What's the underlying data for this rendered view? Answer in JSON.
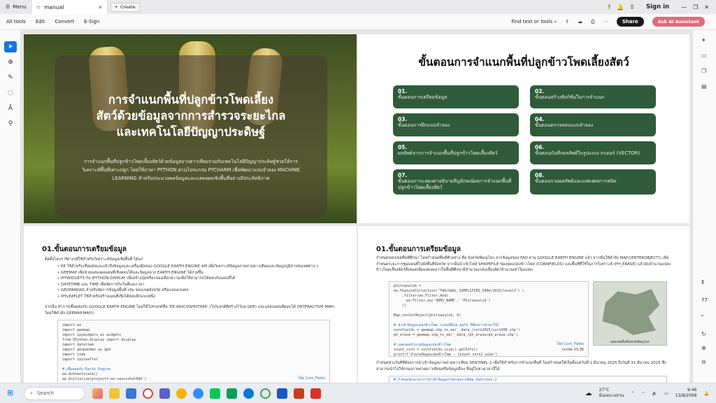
{
  "titlebar": {
    "menu_label": "Menu",
    "tab_title": "manual",
    "create_label": "Create",
    "signin_label": "Sign in"
  },
  "toolbar": {
    "items": [
      "All tools",
      "Edit",
      "Convert",
      "E-Sign"
    ],
    "find_label": "Find text or tools",
    "share_label": "Share",
    "ai_label": "Ask AI Assistant"
  },
  "page_indicator": "77",
  "slide1": {
    "title_lines": [
      "การจำแนกพื้นที่ปลูกข้าวโพดเลี้ยง",
      "สัตว์ด้วยข้อมูลจากการสำรวจระยะไกล",
      "และเทคโนโลยีปัญญาประดิษฐ์"
    ],
    "description": "การจำแนกพื้นที่ปลูกข้าวโพดเลี้ยงสัตว์ด้วยข้อมูลจากดาวเทียมร่วมกับเทคโนโลยีปัญญาประดิษฐ์ช่วยให้การวิเคราะห์พื้นที่เพาะปลูก โดยใช้ภาษา PYTHON ผ่านโปรแกรม PYCHARM เพื่อพัฒนาแบบจำลอง MACHINE LEARNING สำหรับประมวลผลข้อมูลและแสดงผลเชิงพื้นที่อย่างมีประสิทธิภาพ"
  },
  "slide2": {
    "title": "ขั้นตอนการจำแนกพื้นที่ปลูกข้าวโพดเลี้ยงสัตว์",
    "steps": [
      {
        "n": "01.",
        "t": "ขั้นตอนการเตรียมข้อมูล"
      },
      {
        "n": "02.",
        "t": "ขั้นตอนสร้างฟังก์ชันในการจำแนก"
      },
      {
        "n": "03.",
        "t": "ขั้นตอนการฝึกแบบจำลอง"
      },
      {
        "n": "04.",
        "t": "ขั้นตอนตรวจสอบแบบจำลอง"
      },
      {
        "n": "05.",
        "t": "ผลลัพธ์จากการจำแนกพื้นที่ปลูกข้าวโพดเลี้ยงสัตว์"
      },
      {
        "n": "06.",
        "t": "ขั้นตอนบันทึกผลลัพธ์ในรูปแบบเวกเตอร์ (VECTOR)"
      },
      {
        "n": "07.",
        "t": "ขั้นตอนการแสดงค่าอธิบายสัญลักษณ์ผลการจำแนกพื้นที่ปลูกข้าวโพดเลี้ยงสัตว์"
      },
      {
        "n": "08.",
        "t": "ขั้นตอนรวมผลลัพธ์และแสดงผลการสถิต"
      }
    ]
  },
  "slide3": {
    "heading": "01.ขั้นตอนการเตรียมข้อมูล",
    "intro": "ติดตั้งไลบรารีต่างๆที่ใช้สำหรับวิเคราะห์ข้อมูลเชิงพื้นที่ ได้แก่",
    "bullets": [
      "EE ใช้สำหรับเชื่อมต่อและเข้าถึงข้อมูลและเครื่องมือของ GOOGLE EARTH ENGINE API เพื่อวิเคราะห์ข้อมูลภาพถ่ายดาวเทียมและข้อมูลภูมิสารสนเทศต่าง ๆ",
      "GEEMAP เพื่อช่วยแสดงผลแผนที่เชิงตอบโต้และข้อมูลจาก EARTH ENGINE ได้ง่ายขึ้น",
      "IPYWIDGETS กับ IPYTHON.DISPLAY เพื่อสร้างปุ่มหรือกล่องเลือกความเพื่อให้สามารถโต้ตอบกับแผนที่ได้",
      "DATETIME และ TIME เพื่อจัดการกับวันที่และเวลา",
      "GEOPANDAS สำหรับจัดการข้อมูลพื้นที่ เช่น ขอบเขตจังหวัด หรือแปลงเกษตร",
      "IPYLEAFLET ใช้สำหรับสร้างแผนที่เชิงโต้ตอบอีกแบบหนึ่ง"
    ],
    "after": "จากนั้น ทำการเชื่อมต่อกับ GOOGLE EARTH ENGINE โดยใช้โปรเจกต์ชื่อ 'EE-VASCOSHOT666' (โปรเจกต์ที่สร้างไว้บน GEE) และแสดงแผนที่ตอบโต้ (INTERACTIVE MAP) โดยใช้คำสั่ง GEEMAP.MAP()",
    "code": "import ee\nimport geemap\nimport ipywidgets as widgets\nfrom IPython.display import display\nimport datetime\nimport geopandas as gpd\nimport time\nimport ipyleaflet",
    "code_comment": "# เชื่อมต่อกับ Earth Engine",
    "code_tail": "ee.Authenticate()\nee.Initialize(project='ee-vascoshot666')",
    "code_caption": "โค้ด Com_Fields"
  },
  "slide4": {
    "heading": "01.ขั้นตอนการเตรียมข้อมูล",
    "intro": "กำหนดขอบเขตพื้นที่ศึกษา โดยกำหนดพื้นที่ตัวอย่าง คือ จังหวัดพิษณุโลก จากข้อมูลของ FAO ผ่าน GOOGLE EARTH ENGINE แล้ว จากนั้นใช้คำสั่ง MAP.CENTEROBJECT() เพื่อกำหนดระยะการซูมแผนที่ไปยังพื้นที่จังหวัด จากนั้นนำเข้าไฟล์ SHAPEFILE ของจุดแปลงข้าวโพด (CORNFIELDS) และพื้นที่ที่ใช้ในการวิเคราะห์ (PH_ERASE) แล้วนับจำนวนแปลงข้าวโพดเลี้ยงสัตว์ทั้งหมดเพื่อแสดงผลว่าในพื้นที่ศึกษามีจำนวนแปลงเลี้ยงสัตว์จำนวนเท่าใดแปลง",
    "code": "phitsanulok = \nee.FeatureCollection(\"FAO/GAUL_SIMPLIFIED_500m/2015/level1\") \\\n    .filter(ee.Filter.And(\n      ee.Filter.eq('ADM1_NAME', 'Phitsanulok')\n    ))\n\nMap.centerObject(phitsanulok, 9)",
    "code_comment": "# นำเข้าข้อมูลแปลงข้าวโพด (แทนที่ด้วย path ที่ต้องการนำมาใช้)",
    "code_mid": "cornfields = geemap.shp_to_ee('_data_/corn2025/corn300.shp')\nph_erase = geemap.shp_to_ee('_data_/ph_erase/ph_erase.shp')",
    "code_comment2": "# แสดงผลจำนวนข้อมูลแปลงข้าวโพด",
    "code_tail": "count_corn = cornfields.size().getInfo()\nprint(f'จำนวนข้อมูลแปลงข้าวโพด : {count_corn} แปลง')",
    "code_caption": "โค้ด Com_Fields",
    "code_caption2": "บรรทัด 23-36",
    "map_caption": "ขอบเขตพื้นที่จังหวัดพิษณุโลก",
    "after": "กำหนดช่วงวันที่ที่ต้องการนำเข้าข้อมูลภาพถ่ายดาวเทียม SENTINEL-2 เพื่อใช้สำหรับการจำแนกพื้นที่ โดยกำหนดให้เริ่มตั้งแต่วันที่ 1 มีนาคม 2025 ถึงวันที่ 31 มีนาคม 2025 ซึ่งสามารถนำไปใช้กรองภาพถ่ายดาวเทียมหรือข้อมูลอื่นๆ ที่อยู่ในช่วงเวลานี้ได้",
    "code2_comment": "# กำหนดช่วงเวลาการนำเข้าข้อมูลภาพถ่ายดาวเทียม Sentinel-2"
  },
  "taskbar": {
    "search_placeholder": "Search",
    "temp": "27°C",
    "weather": "มีเมฆบางส่วน",
    "time": "9:46",
    "date": "13/8/2568"
  }
}
